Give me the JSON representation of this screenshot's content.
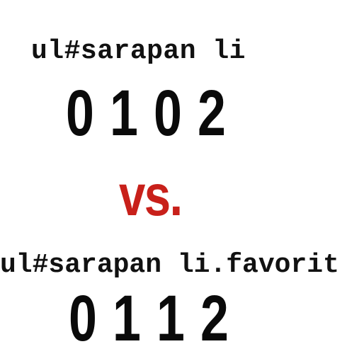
{
  "first": {
    "selector": "ul#sarapan li",
    "specificity": [
      "0",
      "1",
      "0",
      "2"
    ]
  },
  "separator": {
    "label": "vs."
  },
  "second": {
    "selector": "ul#sarapan li.favorit",
    "specificity": [
      "0",
      "1",
      "1",
      "2"
    ]
  },
  "colors": {
    "text": "#0a0a0a",
    "accent": "#c8201a",
    "background": "#ffffff"
  }
}
